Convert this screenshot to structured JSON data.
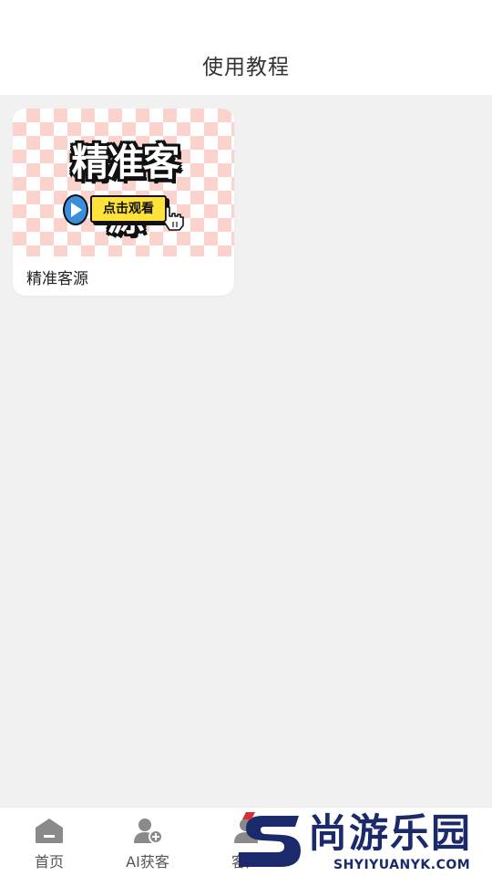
{
  "header": {
    "title": "使用教程"
  },
  "tutorial": {
    "items": [
      {
        "thumbnail_title": "精准客源",
        "thumbnail_button": "点击观看",
        "label": "精准客源"
      }
    ]
  },
  "tabbar": {
    "tabs": [
      {
        "label": "首页",
        "icon": "home-icon"
      },
      {
        "label": "AI获客",
        "icon": "add-user-icon"
      },
      {
        "label": "客户",
        "icon": "customer-icon"
      }
    ]
  },
  "watermark": {
    "brand": "尚游乐园",
    "url": "SHYIYUANYK.COM"
  },
  "colors": {
    "background": "#f1f1f2",
    "thumb_pink": "#fbd2cc",
    "watch_yellow": "#ffe23a",
    "play_blue": "#3a8fdc",
    "watermark_navy": "#1b2a6b",
    "watermark_red": "#d62e3a"
  }
}
